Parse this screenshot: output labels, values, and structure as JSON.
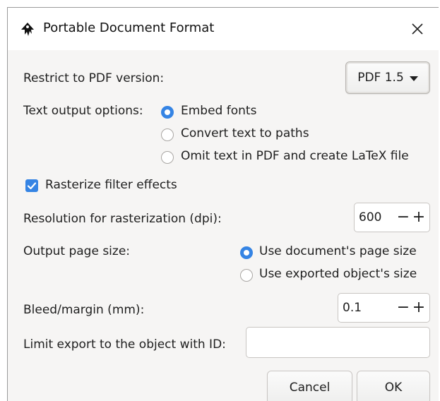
{
  "window": {
    "title": "Portable Document Format",
    "close_glyph": "✕"
  },
  "pdf_version": {
    "label": "Restrict to PDF version:",
    "selected": "PDF 1.5"
  },
  "text_output": {
    "label": "Text output options:",
    "options": [
      {
        "label": "Embed fonts",
        "checked": true
      },
      {
        "label": "Convert text to paths",
        "checked": false
      },
      {
        "label": "Omit text in PDF and create LaTeX file",
        "checked": false
      }
    ]
  },
  "rasterize": {
    "label": "Rasterize filter effects",
    "checked": true
  },
  "resolution": {
    "label": "Resolution for rasterization (dpi):",
    "value": "600",
    "minus": "−",
    "plus": "+"
  },
  "page_size": {
    "label": "Output page size:",
    "options": [
      {
        "label": "Use document's page size",
        "checked": true
      },
      {
        "label": "Use exported object's size",
        "checked": false
      }
    ]
  },
  "bleed": {
    "label": "Bleed/margin (mm):",
    "value": "0.1",
    "minus": "−",
    "plus": "+"
  },
  "limit_export": {
    "label": "Limit export to the object with ID:",
    "value": ""
  },
  "buttons": {
    "cancel": "Cancel",
    "ok": "OK"
  },
  "colors": {
    "accent": "#3584e4",
    "dialog_bg": "#f6f5f4",
    "titlebar_bg": "#ffffff"
  },
  "icons": {
    "app": "inkscape-icon",
    "close": "close-icon",
    "dropdown": "chevron-down-icon",
    "check": "check-icon"
  }
}
